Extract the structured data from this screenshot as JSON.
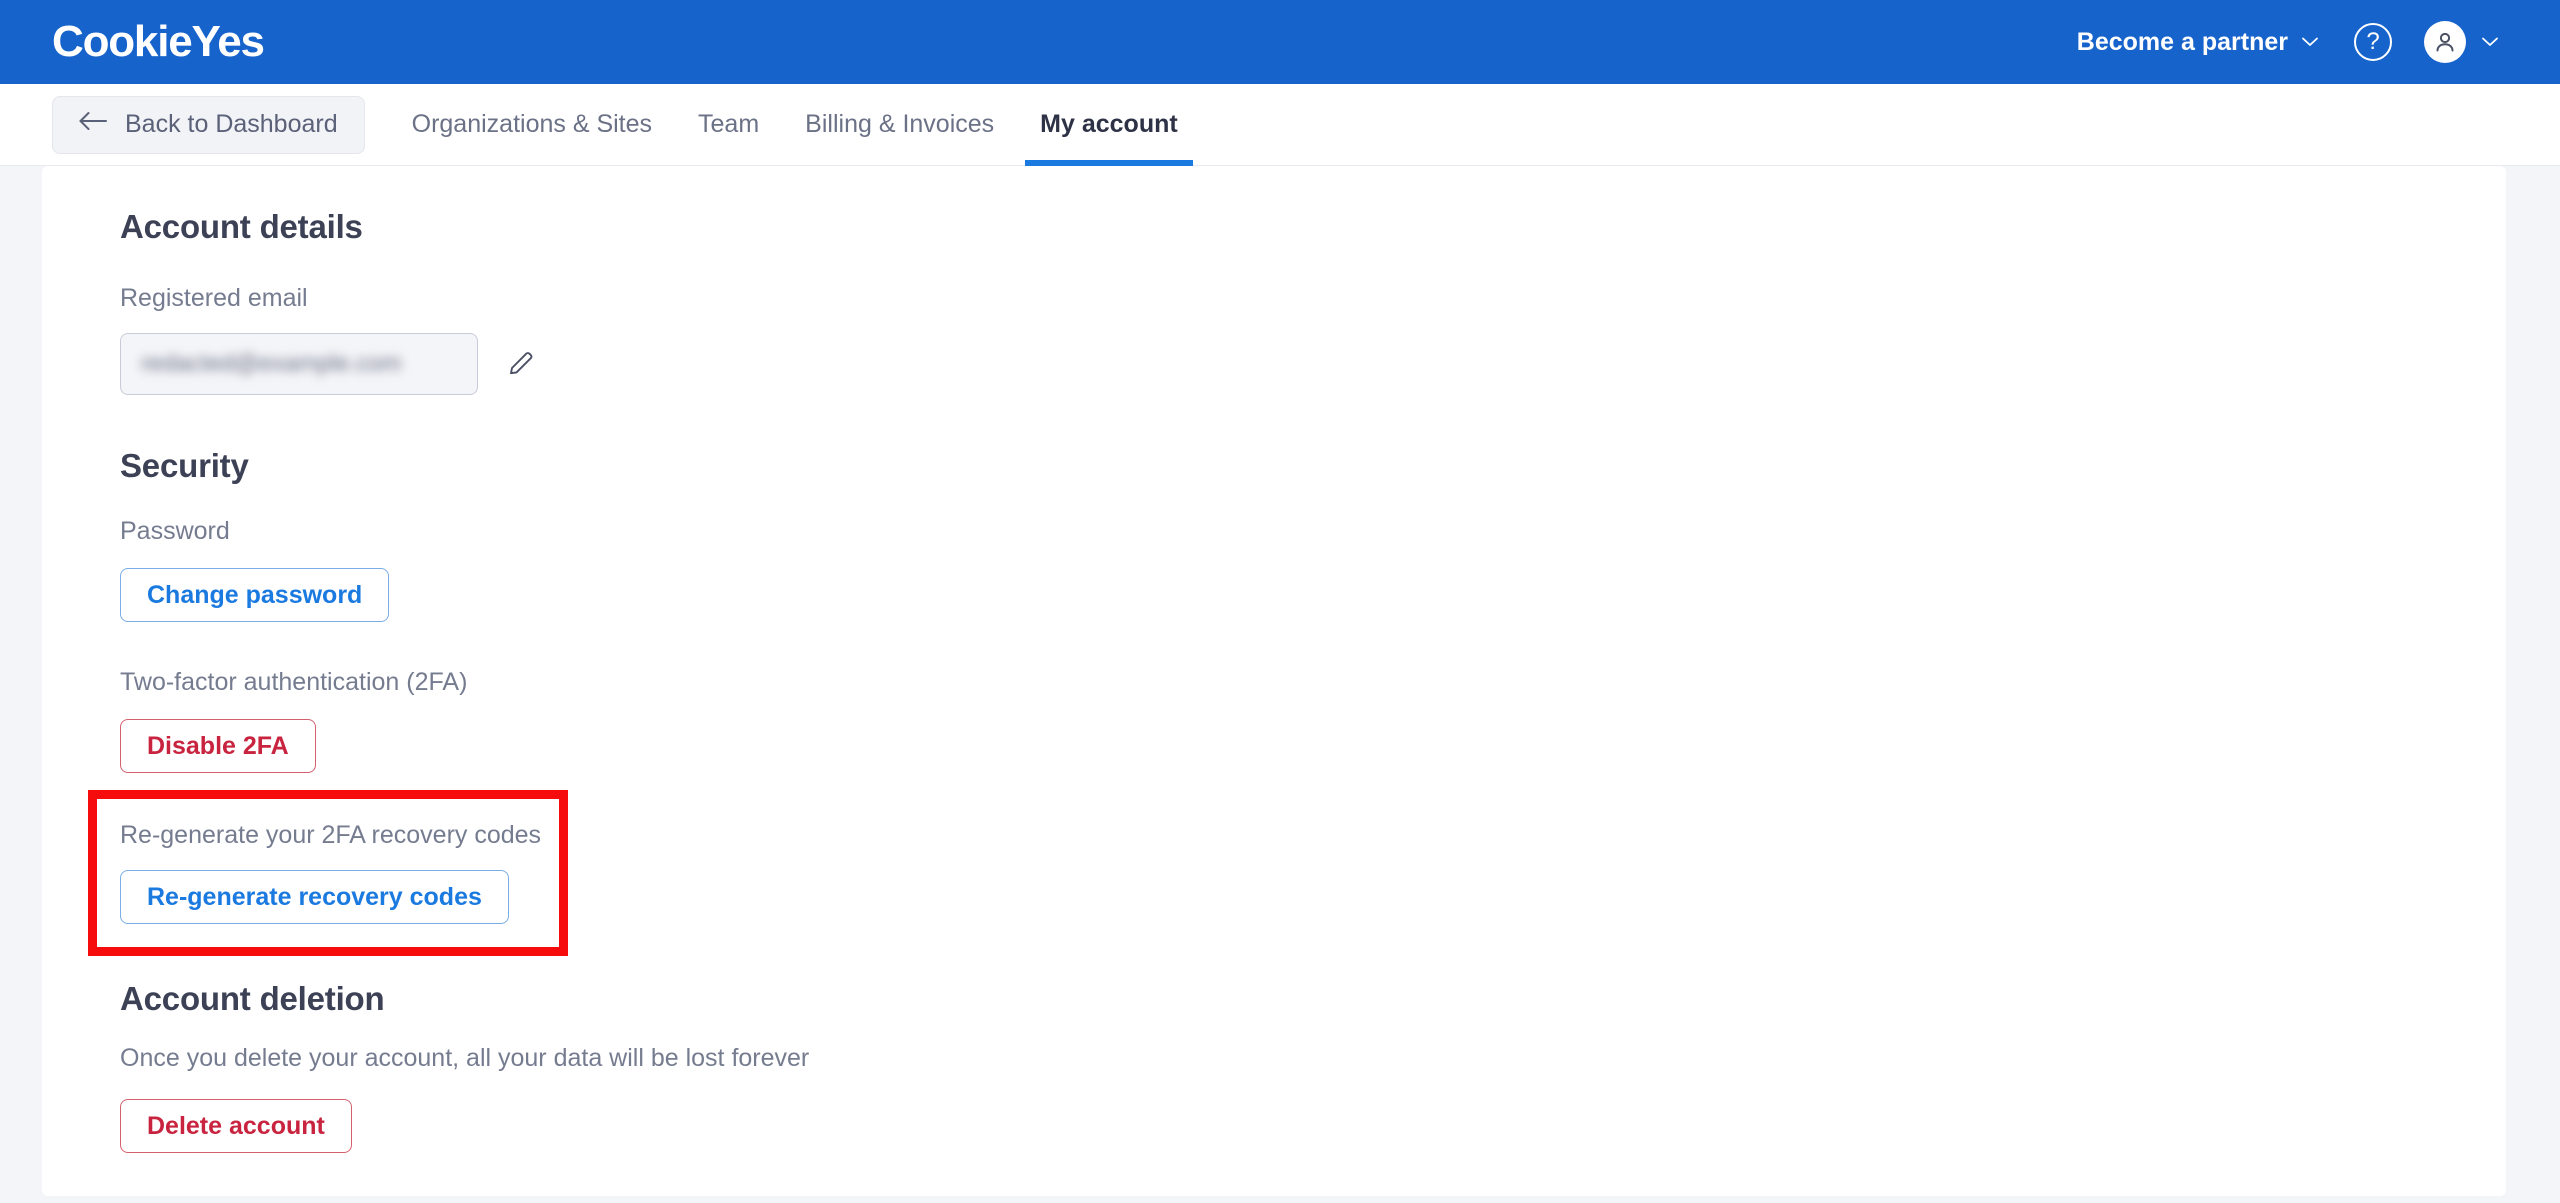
{
  "header": {
    "logo_text": "CookieYes",
    "partner_label": "Become a partner",
    "partner_chevron_icon": "chevron-down-icon",
    "help_icon": "question-mark-circle-icon",
    "help_glyph": "?",
    "avatar_icon": "user-avatar-icon",
    "avatar_chevron_icon": "chevron-down-icon",
    "brand_color": "#1763cc"
  },
  "nav": {
    "back_button": {
      "label": "Back to Dashboard",
      "icon": "arrow-left-icon"
    },
    "tabs": [
      {
        "label": "Organizations & Sites",
        "active": false
      },
      {
        "label": "Team",
        "active": false
      },
      {
        "label": "Billing & Invoices",
        "active": false
      },
      {
        "label": "My account",
        "active": true
      }
    ],
    "active_underline_color": "#1b7ae0"
  },
  "account_details": {
    "title": "Account details",
    "email_label": "Registered email",
    "email_value": "redacted@example.com",
    "email_redacted": true,
    "edit_icon": "pencil-edit-icon"
  },
  "security": {
    "title": "Security",
    "password_label": "Password",
    "change_password_button": "Change password",
    "twofa_label": "Two-factor authentication (2FA)",
    "disable_twofa_button": "Disable 2FA",
    "recovery_codes_label": "Re-generate your 2FA recovery codes",
    "regenerate_button": "Re-generate recovery codes"
  },
  "account_deletion": {
    "title": "Account deletion",
    "description": "Once you delete your account, all your data will be lost forever",
    "delete_button": "Delete account"
  },
  "annotation": {
    "color": "#f60c0c",
    "target": "recovery-codes-section"
  }
}
